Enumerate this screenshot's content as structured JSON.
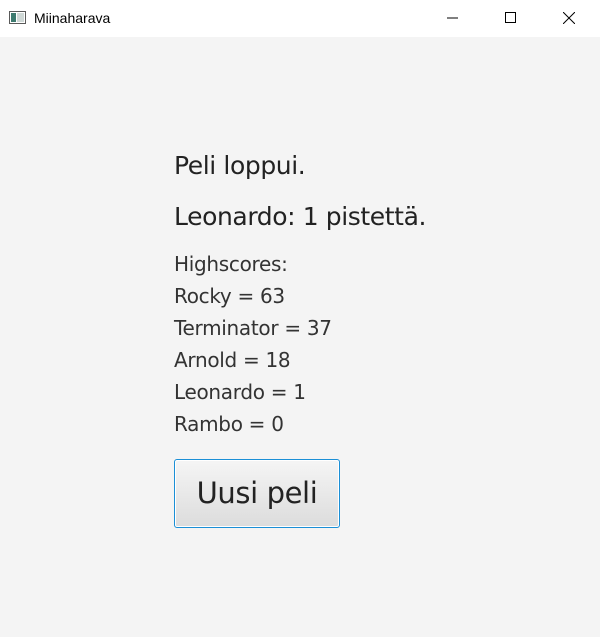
{
  "window": {
    "title": "Miinaharava"
  },
  "game_over": {
    "message": "Peli loppui.",
    "result": "Leonardo: 1 pistettä."
  },
  "highscores": {
    "heading": "Highscores:",
    "entries": [
      "Rocky = 63",
      "Terminator = 37",
      "Arnold = 18",
      "Leonardo = 1",
      "Rambo = 0"
    ]
  },
  "actions": {
    "new_game_label": "Uusi peli"
  },
  "colors": {
    "background": "#f4f4f4",
    "accent_border": "#1b8fd6",
    "text": "#222222"
  },
  "icons": {
    "app": "app-window-icon",
    "minimize": "minimize-icon",
    "maximize": "maximize-icon",
    "close": "close-icon"
  }
}
